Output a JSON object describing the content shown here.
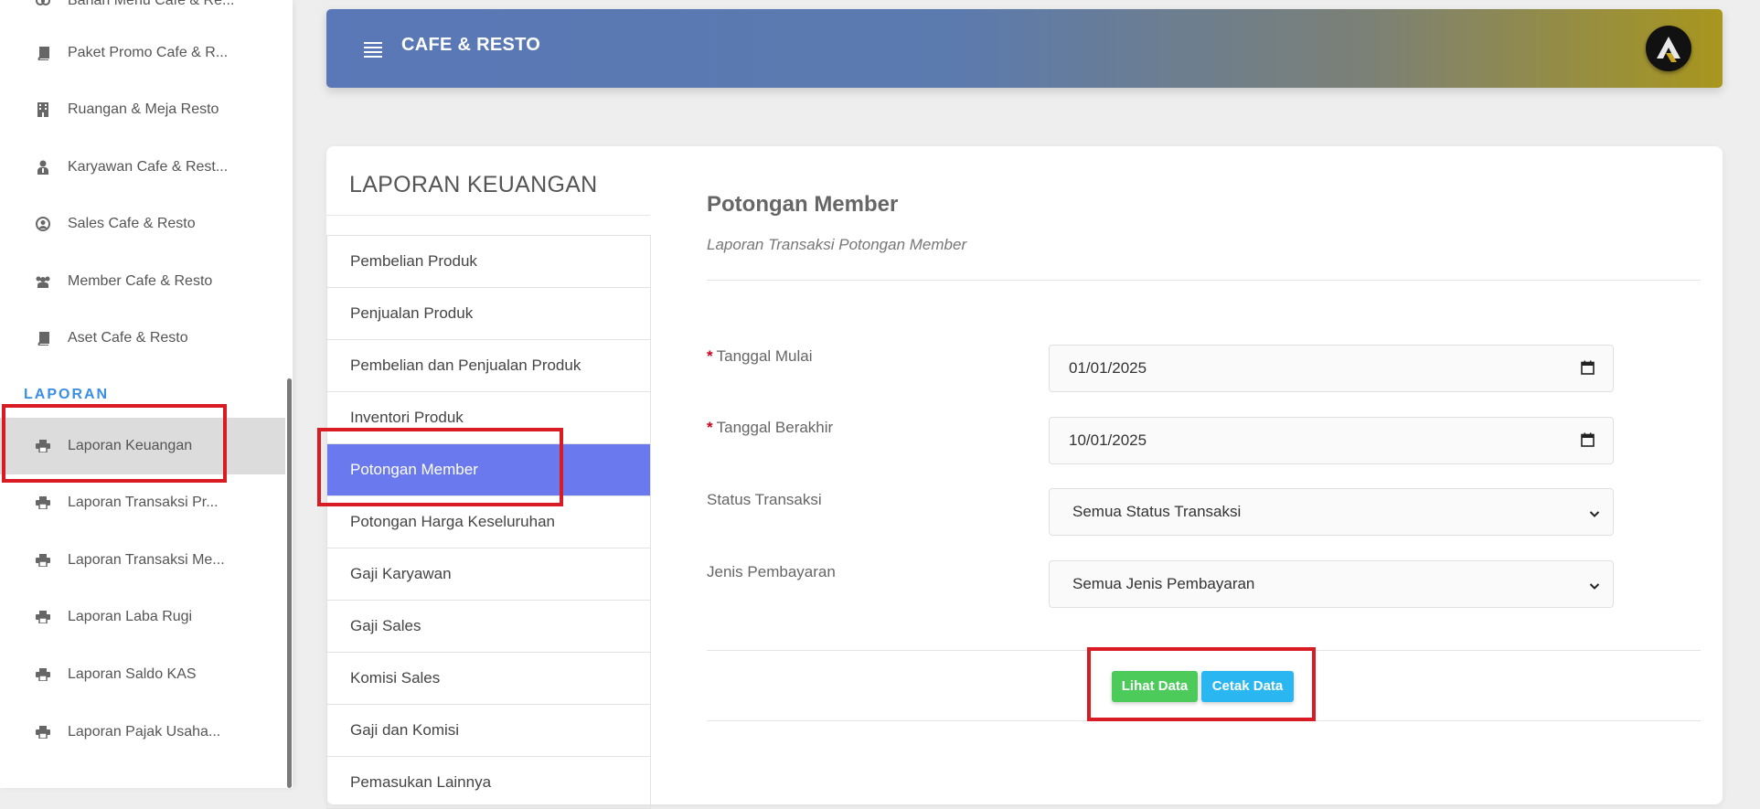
{
  "sidebar": {
    "top_partial_label": "Bahan Menu Cafe & Re...",
    "items": [
      {
        "label": "Paket Promo Cafe & R...",
        "icon": "book-icon"
      },
      {
        "label": "Ruangan & Meja Resto",
        "icon": "building-icon"
      },
      {
        "label": "Karyawan Cafe & Rest...",
        "icon": "user-tie-icon"
      },
      {
        "label": "Sales Cafe & Resto",
        "icon": "user-circle-icon"
      },
      {
        "label": "Member Cafe & Resto",
        "icon": "users-icon"
      },
      {
        "label": "Aset Cafe & Resto",
        "icon": "book-icon"
      }
    ],
    "section_label": "LAPORAN",
    "report_items": [
      {
        "label": "Laporan Keuangan",
        "icon": "printer-icon",
        "active": true
      },
      {
        "label": "Laporan Transaksi Pr...",
        "icon": "printer-icon"
      },
      {
        "label": "Laporan Transaksi Me...",
        "icon": "printer-icon"
      },
      {
        "label": "Laporan Laba Rugi",
        "icon": "printer-icon"
      },
      {
        "label": "Laporan Saldo KAS",
        "icon": "printer-icon"
      },
      {
        "label": "Laporan Pajak Usaha...",
        "icon": "printer-icon"
      }
    ]
  },
  "header": {
    "title": "CAFE & RESTO",
    "menu_icon": "hamburger-icon",
    "avatar_icon": "logo-avatar"
  },
  "report_menu": {
    "title": "LAPORAN KEUANGAN",
    "items": [
      "Pembelian Produk",
      "Penjualan Produk",
      "Pembelian dan Penjualan Produk",
      "Inventori Produk",
      "Potongan Member",
      "Potongan Harga Keseluruhan",
      "Gaji Karyawan",
      "Gaji Sales",
      "Komisi Sales",
      "Gaji dan Komisi",
      "Pemasukan Lainnya"
    ],
    "active_index": 4
  },
  "content": {
    "title": "Potongan Member",
    "subtitle": "Laporan Transaksi Potongan Member",
    "required_mark": "*",
    "fields": {
      "start_date": {
        "label": "Tanggal Mulai",
        "value": "01/01/2025"
      },
      "end_date": {
        "label": "Tanggal Berakhir",
        "value": "10/01/2025"
      },
      "status": {
        "label": "Status Transaksi",
        "value": "Semua Status Transaksi"
      },
      "payment": {
        "label": "Jenis Pembayaran",
        "value": "Semua Jenis Pembayaran"
      }
    },
    "buttons": {
      "view": "Lihat Data",
      "print": "Cetak Data"
    }
  },
  "colors": {
    "active_menu": "#6a7aee",
    "section_label": "#3a8ee6",
    "btn_view": "#4cca5a",
    "btn_print": "#2ab6f0",
    "highlight": "#d91c24"
  }
}
